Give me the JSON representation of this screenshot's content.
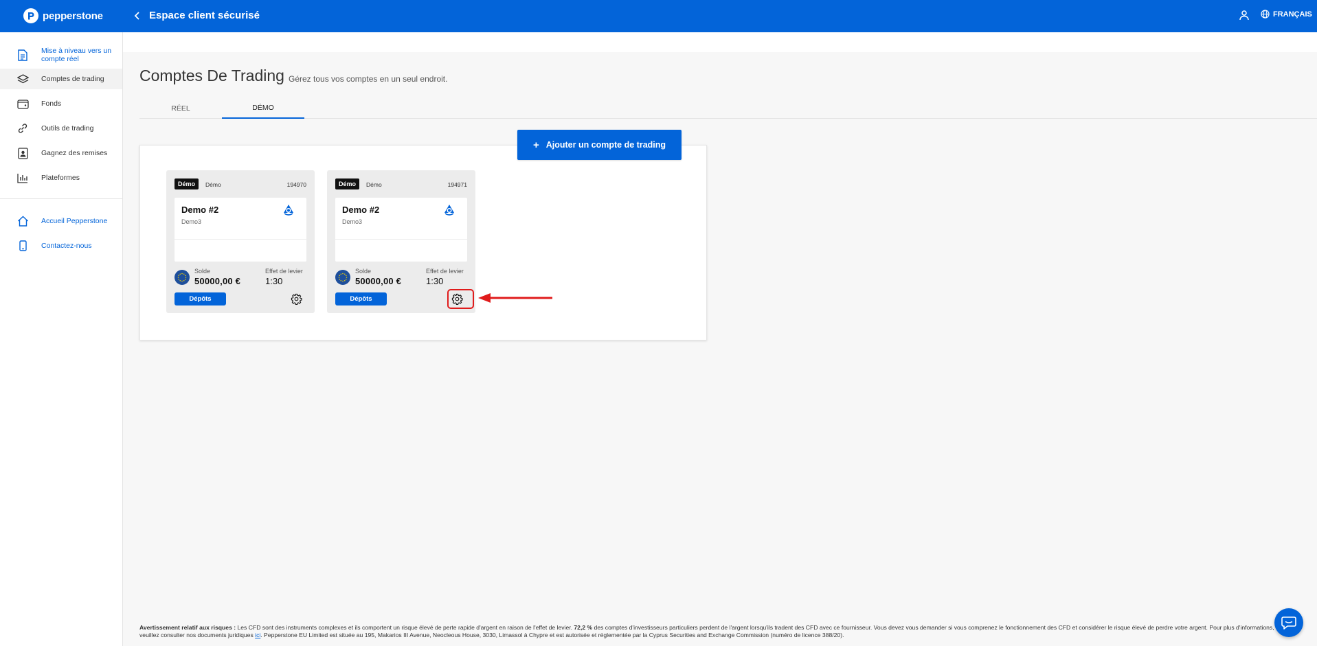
{
  "header": {
    "logo_text": "pepperstone",
    "title": "Espace client sécurisé",
    "language": "FRANÇAIS"
  },
  "sidebar": {
    "items": [
      {
        "label": "Mise à niveau vers un compte réel",
        "icon": "document-icon"
      },
      {
        "label": "Comptes de trading",
        "icon": "layers-icon"
      },
      {
        "label": "Fonds",
        "icon": "wallet-icon"
      },
      {
        "label": "Outils de trading",
        "icon": "link-icon"
      },
      {
        "label": "Gagnez des remises",
        "icon": "user-card-icon"
      },
      {
        "label": "Plateformes",
        "icon": "bar-chart-icon"
      }
    ],
    "links": [
      {
        "label": "Accueil Pepperstone",
        "icon": "home-icon"
      },
      {
        "label": "Contactez-nous",
        "icon": "phone-icon"
      }
    ]
  },
  "main": {
    "title": "Comptes De Trading",
    "subtitle": "Gérez tous vos comptes en un seul endroit.",
    "tabs": [
      {
        "label": "RÉEL",
        "active": false
      },
      {
        "label": "DÉMO",
        "active": true
      }
    ],
    "add_button": "Ajouter un compte de trading"
  },
  "accounts": [
    {
      "badge": "Démo",
      "type": "Démo",
      "number": "194970",
      "name": "Demo #2",
      "sub": "Demo3",
      "balance_label": "Solde",
      "balance": "50000,00 €",
      "leverage_label": "Effet de levier",
      "leverage": "1:30",
      "deposit_label": "Dépôts"
    },
    {
      "badge": "Démo",
      "type": "Démo",
      "number": "194971",
      "name": "Demo #2",
      "sub": "Demo3",
      "balance_label": "Solde",
      "balance": "50000,00 €",
      "leverage_label": "Effet de levier",
      "leverage": "1:30",
      "deposit_label": "Dépôts"
    }
  ],
  "disclaimer": {
    "title": "Avertissement relatif aux risques :",
    "part1": " Les CFD sont des instruments complexes et ils comportent un risque élevé de perte rapide d'argent en raison de l'effet de levier. ",
    "percent": "72,2 %",
    "part2": " des comptes d'investisseurs particuliers perdent de l'argent lorsqu'ils tradent des CFD avec ce fournisseur. Vous devez vous demander si vous comprenez le fonctionnement des CFD et considérer le risque élevé de perdre votre argent. Pour plus d'informations, veuillez consulter nos documents juridiques ",
    "link": "ici",
    "part3": ". Pepperstone EU Limited est située au 195, Makarios III Avenue, Neocleous House, 3030, Limassol à Chypre et est autorisée et réglementée par la Cyprus Securities and Exchange Commission (numéro de licence 388/20)."
  },
  "colors": {
    "brand": "#0364d9",
    "annotation": "#e01b1b"
  }
}
